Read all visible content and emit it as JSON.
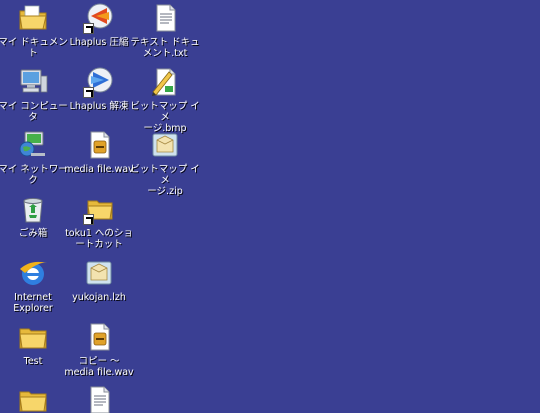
{
  "desktop": {
    "background_color": "#3a3f93",
    "icons": [
      {
        "label": "マイ ドキュメント",
        "icon": "my-documents-icon"
      },
      {
        "label": "マイ コンピュータ",
        "icon": "my-computer-icon"
      },
      {
        "label": "マイ ネットワーク",
        "icon": "my-network-icon"
      },
      {
        "label": "ごみ箱",
        "icon": "recycle-bin-icon"
      },
      {
        "label": "Internet\nExplorer",
        "icon": "internet-explorer-icon"
      },
      {
        "label": "Test",
        "icon": "folder-icon"
      },
      {
        "label": "",
        "icon": "folder-icon"
      },
      {
        "label": "Lhaplus 圧縮",
        "icon": "lhaplus-compress-icon"
      },
      {
        "label": "Lhaplus 解凍",
        "icon": "lhaplus-extract-icon"
      },
      {
        "label": "media file.wav",
        "icon": "wav-file-icon"
      },
      {
        "label": "toku1 へのショ\nートカット",
        "icon": "folder-shortcut-icon"
      },
      {
        "label": "yukojan.lzh",
        "icon": "lzh-archive-icon"
      },
      {
        "label": "コピー ～\nmedia file.wav",
        "icon": "wav-file-icon"
      },
      {
        "label": "",
        "icon": "text-file-icon"
      },
      {
        "label": "テキスト ドキュ\nメント.txt",
        "icon": "text-file-icon"
      },
      {
        "label": "ビットマップ イメ\nージ.bmp",
        "icon": "bitmap-image-icon"
      },
      {
        "label": "ビットマップ イメ\nージ.zip",
        "icon": "zip-archive-icon"
      }
    ]
  }
}
